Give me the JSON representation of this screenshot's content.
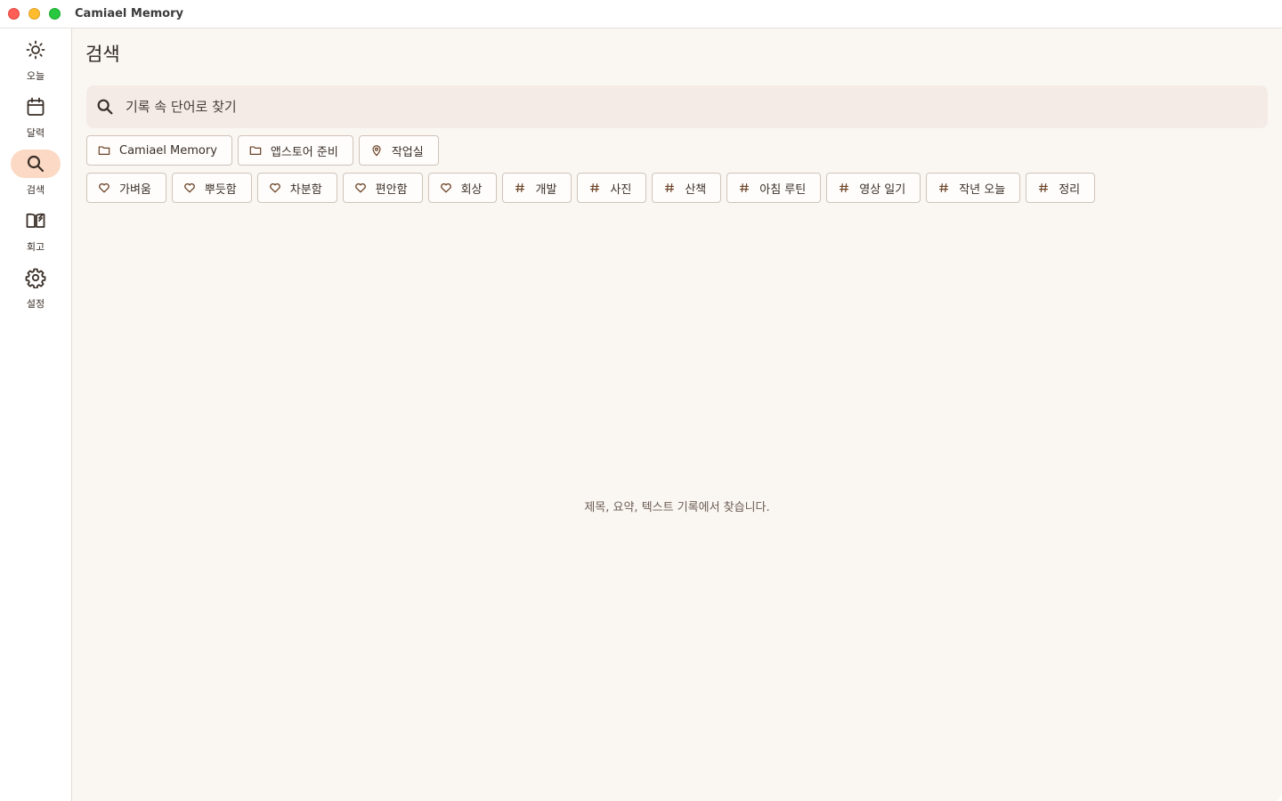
{
  "window": {
    "title": "Camiael Memory"
  },
  "sidebar": {
    "items": [
      {
        "label": "오늘",
        "icon": "sun-icon"
      },
      {
        "label": "달력",
        "icon": "calendar-icon"
      },
      {
        "label": "검색",
        "icon": "search-icon",
        "active": true
      },
      {
        "label": "회고",
        "icon": "book-icon"
      },
      {
        "label": "설정",
        "icon": "gear-icon"
      }
    ]
  },
  "main": {
    "title": "검색",
    "search": {
      "placeholder": "기록 속 단어로 찾기",
      "value": ""
    },
    "chips_row1": [
      {
        "label": "Camiael Memory",
        "icon": "folder-icon"
      },
      {
        "label": "앱스토어 준비",
        "icon": "folder-icon"
      },
      {
        "label": "작업실",
        "icon": "location-pin-icon"
      }
    ],
    "chips_row2": [
      {
        "label": "가벼움",
        "icon": "heart-icon"
      },
      {
        "label": "뿌듯함",
        "icon": "heart-icon"
      },
      {
        "label": "차분함",
        "icon": "heart-icon"
      },
      {
        "label": "편안함",
        "icon": "heart-icon"
      },
      {
        "label": "회상",
        "icon": "heart-icon"
      },
      {
        "label": "개발",
        "icon": "hash-icon"
      },
      {
        "label": "사진",
        "icon": "hash-icon"
      },
      {
        "label": "산책",
        "icon": "hash-icon"
      },
      {
        "label": "아침 루틴",
        "icon": "hash-icon"
      },
      {
        "label": "영상 일기",
        "icon": "hash-icon"
      },
      {
        "label": "작년 오늘",
        "icon": "hash-icon"
      },
      {
        "label": "정리",
        "icon": "hash-icon"
      }
    ],
    "empty_message": "제목, 요약, 텍스트 기록에서 찾습니다."
  },
  "colors": {
    "accent": "#fbd9c4",
    "background": "#faf6f2",
    "search_bg": "#f4ebe6",
    "icon_brown": "#6b4226",
    "chip_border": "#cfc3b9"
  }
}
